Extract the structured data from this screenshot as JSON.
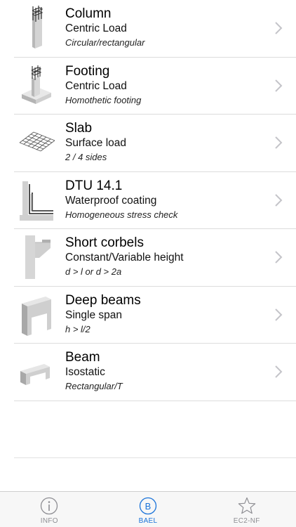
{
  "items": [
    {
      "title": "Column",
      "subtitle": "Centric Load",
      "description": "Circular/rectangular",
      "icon": "column-icon"
    },
    {
      "title": "Footing",
      "subtitle": "Centric Load",
      "description": "Homothetic footing",
      "icon": "footing-icon"
    },
    {
      "title": "Slab",
      "subtitle": "Surface load",
      "description": "2 / 4 sides",
      "icon": "slab-icon"
    },
    {
      "title": "DTU 14.1",
      "subtitle": "Waterproof coating",
      "description": "Homogeneous stress check",
      "icon": "dtu-icon"
    },
    {
      "title": "Short corbels",
      "subtitle": "Constant/Variable height",
      "description": "d > l or d > 2a",
      "icon": "corbel-icon"
    },
    {
      "title": "Deep beams",
      "subtitle": "Single span",
      "description": "h > l/2",
      "icon": "deep-beam-icon"
    },
    {
      "title": "Beam",
      "subtitle": "Isostatic",
      "description": "Rectangular/T",
      "icon": "beam-icon"
    }
  ],
  "tabbar": {
    "tabs": [
      {
        "label": "INFO",
        "icon": "info-icon",
        "active": false
      },
      {
        "label": "BAEL",
        "icon": "b-circle-icon",
        "active": true
      },
      {
        "label": "EC2-NF",
        "icon": "star-icon",
        "active": false
      }
    ],
    "active_color": "#1a73d9",
    "inactive_color": "#8e8e93"
  }
}
